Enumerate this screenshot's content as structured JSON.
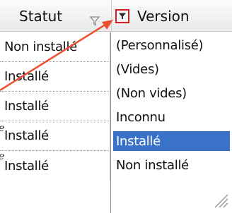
{
  "header": {
    "statut_label": "Statut",
    "version_label": "Version"
  },
  "rows": [
    {
      "status": "Non installé"
    },
    {
      "status": "Installé"
    },
    {
      "status": "Installé"
    },
    {
      "status": "Installé"
    },
    {
      "status": "Installé"
    }
  ],
  "side_text": [
    "e",
    "e"
  ],
  "filter_dropdown": {
    "options": [
      "(Personnalisé)",
      "(Vides)",
      "(Non vides)",
      "Inconnu",
      "Installé",
      "Non installé"
    ],
    "selected": "Installé"
  },
  "colors": {
    "highlight_border": "#d81e1e",
    "selection": "#3a72c8",
    "arrow": "#e8502f"
  },
  "icons": [
    "funnel-filter-icon",
    "filter-dropdown-button-icon",
    "resize-grip-icon"
  ]
}
